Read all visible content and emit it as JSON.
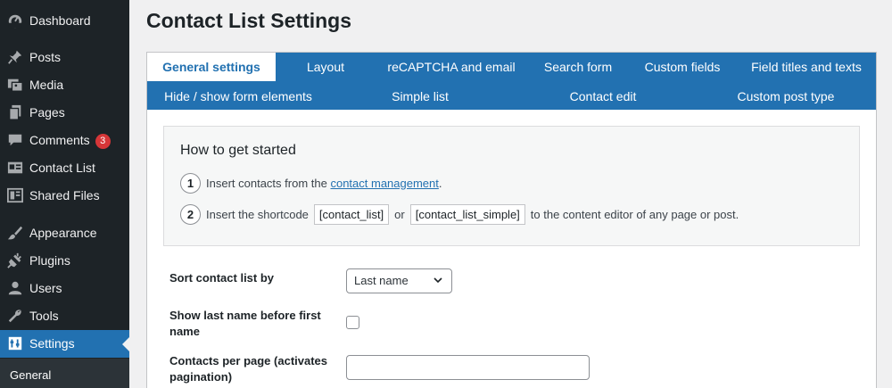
{
  "sidebar": {
    "items": [
      {
        "label": "Dashboard",
        "icon": "dashboard-icon"
      },
      {
        "label": "Posts",
        "icon": "pin-icon"
      },
      {
        "label": "Media",
        "icon": "media-icon"
      },
      {
        "label": "Pages",
        "icon": "pages-icon"
      },
      {
        "label": "Comments",
        "icon": "comment-icon",
        "badge": "3"
      },
      {
        "label": "Contact List",
        "icon": "contact-card-icon"
      },
      {
        "label": "Shared Files",
        "icon": "shared-files-icon"
      },
      {
        "label": "Appearance",
        "icon": "brush-icon"
      },
      {
        "label": "Plugins",
        "icon": "plugin-icon"
      },
      {
        "label": "Users",
        "icon": "user-icon"
      },
      {
        "label": "Tools",
        "icon": "wrench-icon"
      },
      {
        "label": "Settings",
        "icon": "settings-icon",
        "active": true
      }
    ],
    "submenu": {
      "label": "General"
    }
  },
  "page": {
    "title": "Contact List Settings"
  },
  "tabs": {
    "row1": [
      "General settings",
      "Layout",
      "reCAPTCHA and email",
      "Search form",
      "Custom fields",
      "Field titles and texts"
    ],
    "row2": [
      "Hide / show form elements",
      "Simple list",
      "Contact edit",
      "Custom post type"
    ],
    "active": "General settings"
  },
  "howto": {
    "title": "How to get started",
    "step1": {
      "num": "1",
      "text": "Insert contacts from the ",
      "link": "contact management",
      "suffix": "."
    },
    "step2": {
      "num": "2",
      "text": "Insert the shortcode",
      "code1": "[contact_list]",
      "or": "or",
      "code2": "[contact_list_simple]",
      "suffix": "to the content editor of any page or post."
    }
  },
  "form": {
    "sort_label": "Sort contact list by",
    "sort_value": "Last name",
    "lastname_first_label": "Show last name before first name",
    "lastname_first_checked": false,
    "per_page_label": "Contacts per page (activates pagination)",
    "per_page_value": ""
  },
  "colors": {
    "sidebar": "#1d2327",
    "accent": "#2271b1",
    "badge": "#d63638"
  }
}
